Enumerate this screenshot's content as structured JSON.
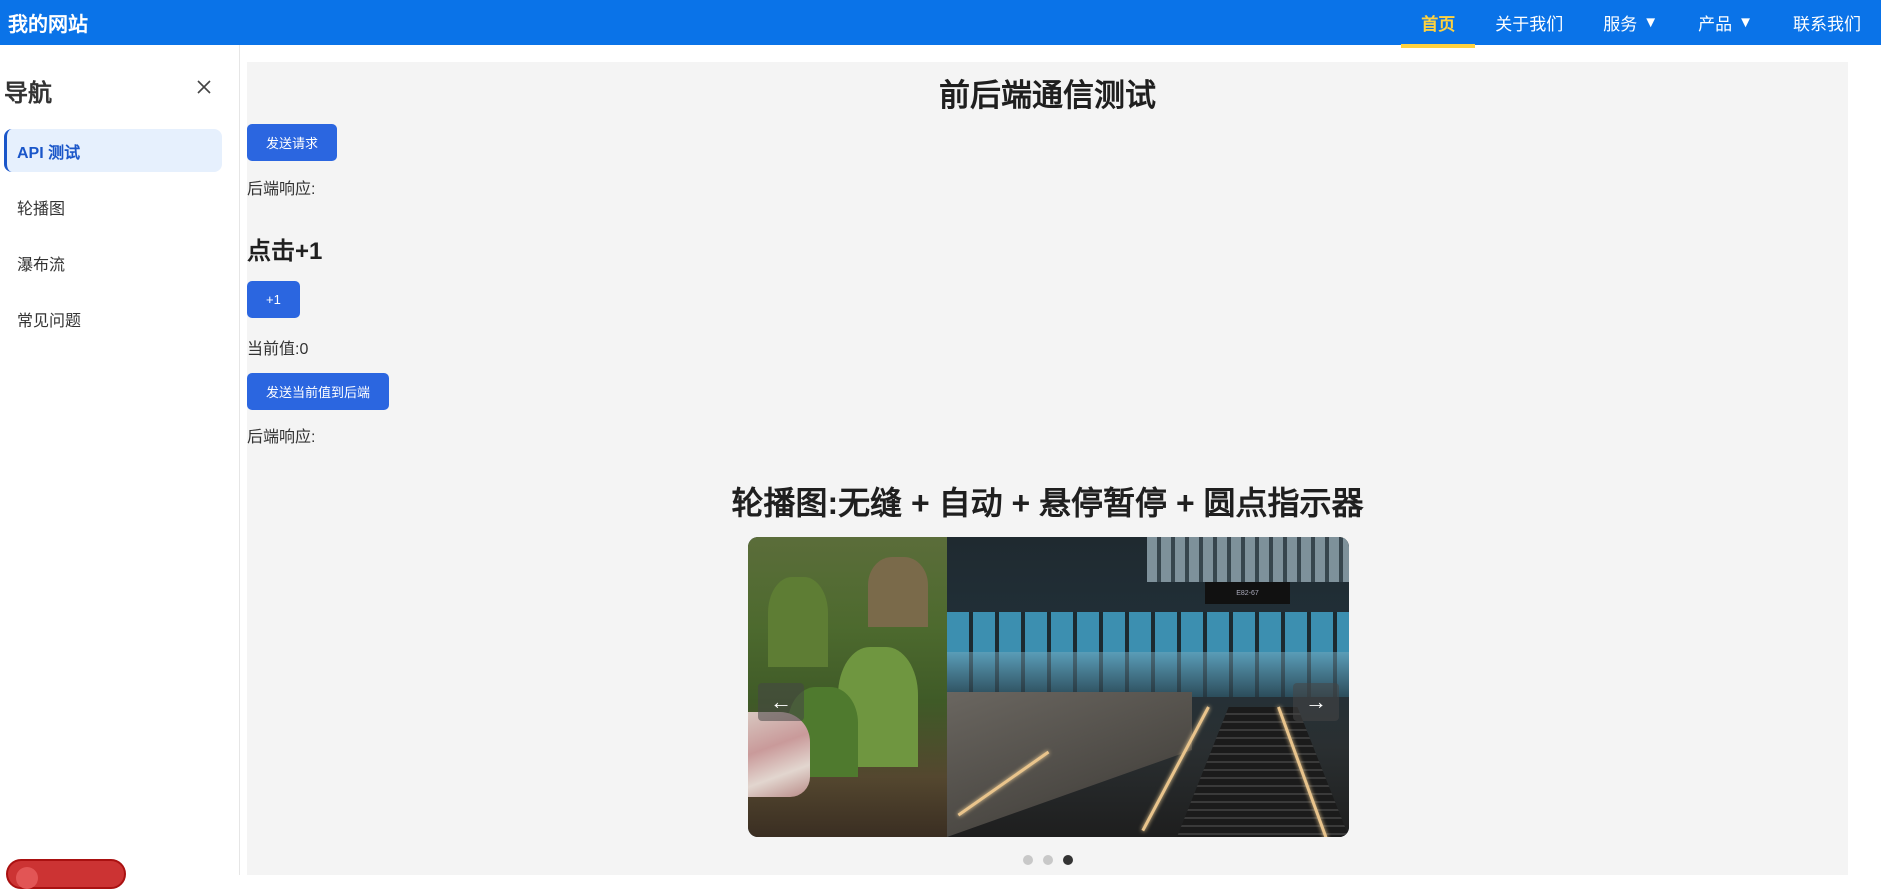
{
  "header": {
    "brand": "我的网站",
    "menu": [
      {
        "label": "首页",
        "active": true
      },
      {
        "label": "关于我们",
        "active": false
      },
      {
        "label": "服务",
        "caret": "▼",
        "active": false
      },
      {
        "label": "产品",
        "caret": "▼",
        "active": false
      },
      {
        "label": "联系我们",
        "active": false
      }
    ]
  },
  "sidebar": {
    "title": "导航",
    "close_icon": "close-icon",
    "items": [
      {
        "label": "API 测试",
        "active": true
      },
      {
        "label": "轮播图",
        "active": false
      },
      {
        "label": "瀑布流",
        "active": false
      },
      {
        "label": "常见问题",
        "active": false
      }
    ]
  },
  "main": {
    "title": "前后端通信测试",
    "send_request_label": "发送请求",
    "response_label_1": "后端响应:",
    "counter_title": "点击+1",
    "plus_one_label": "+1",
    "current_value_label": "当前值:",
    "current_value": "0",
    "send_value_label": "发送当前值到后端",
    "response_label_2": "后端响应:"
  },
  "carousel": {
    "title": "轮播图:无缝 + 自动 + 悬停暂停 + 圆点指示器",
    "prev_arrow": "←",
    "next_arrow": "→",
    "dot_count": 3,
    "active_dot": 3
  },
  "colors": {
    "nav_bg": "#0a73e8",
    "nav_active": "#ffd23f",
    "button_bg": "#2b66e0",
    "sidebar_active_bg": "#e6f0fd",
    "sidebar_active_text": "#1a56c9",
    "main_bg": "#f4f4f4"
  }
}
